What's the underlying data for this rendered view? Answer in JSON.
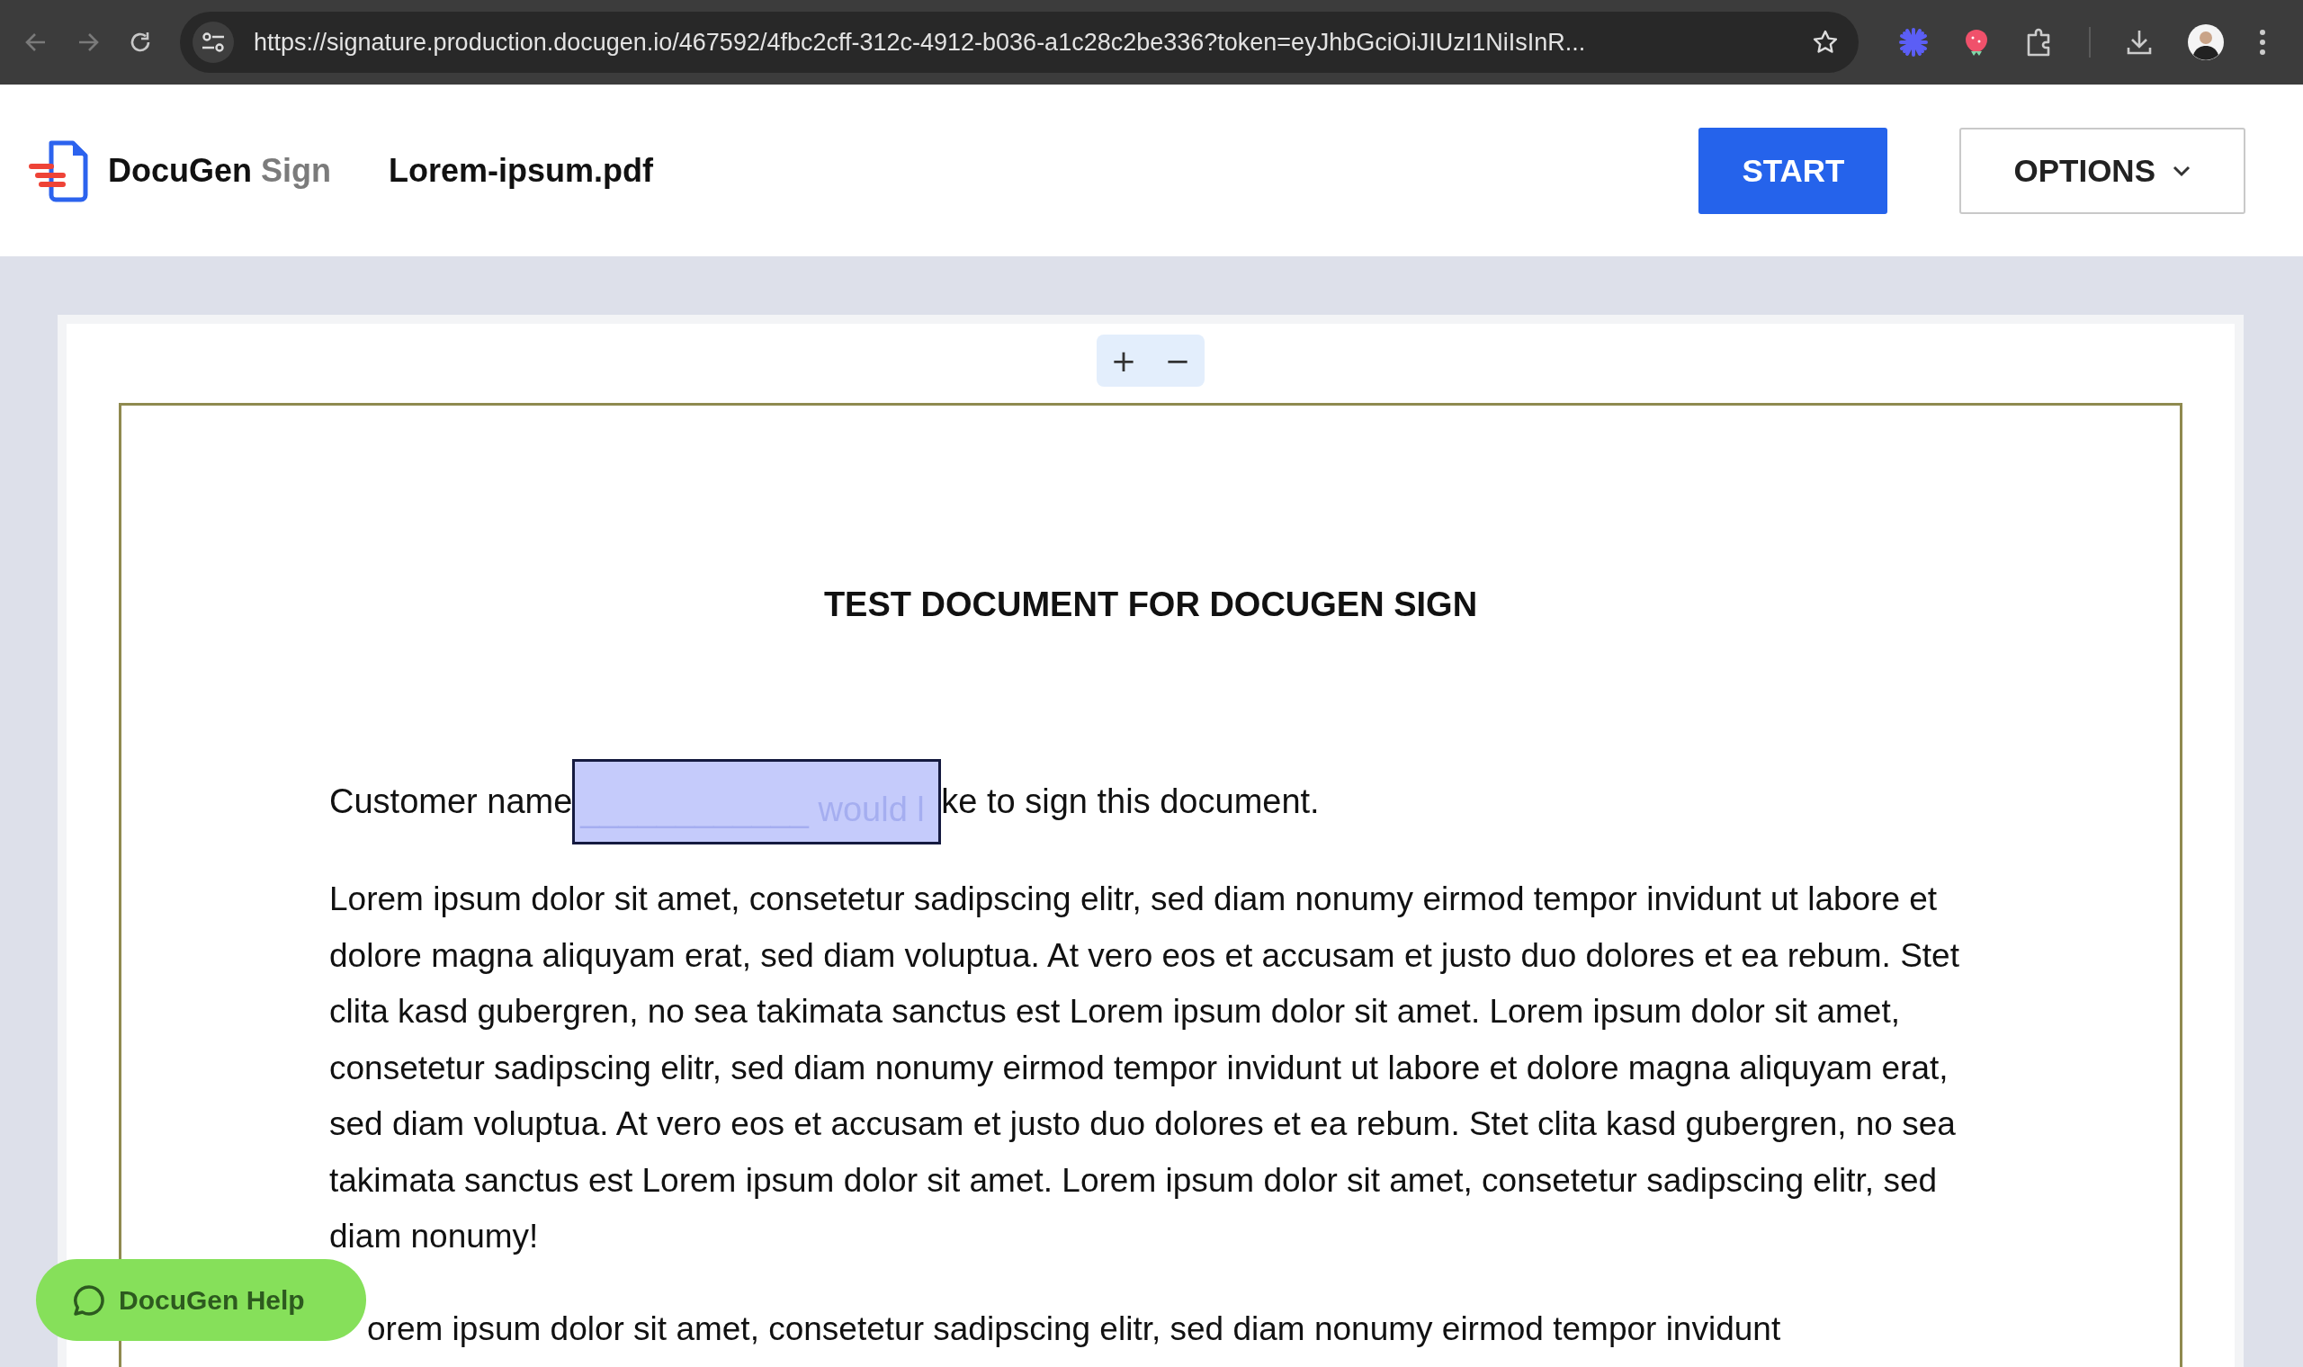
{
  "browser": {
    "url": "https://signature.production.docugen.io/467592/4fbc2cff-312c-4912-b036-a1c28c2be336?token=eyJhbGciOiJIUzI1NiIsInR..."
  },
  "header": {
    "brand": "DocuGen",
    "brand_suffix": "Sign",
    "file_name": "Lorem-ipsum.pdf",
    "buttons": [
      {
        "label": "START",
        "kind": "primary"
      },
      {
        "label": "OPTIONS",
        "kind": "dropdown"
      }
    ]
  },
  "zoom_controls": [
    "+",
    "−"
  ],
  "document": {
    "title": "TEST DOCUMENT FOR DOCUGEN SIGN",
    "intro": {
      "before": "Customer name",
      "field_covered_text": "____________ would l",
      "after": "ke to sign this document."
    },
    "paragraphs": [
      "Lorem ipsum dolor sit amet, consetetur sadipscing elitr, sed diam nonumy eirmod tempor invidunt ut labore et dolore magna aliquyam erat, sed diam voluptua. At vero eos et accusam et justo duo dolores et ea rebum. Stet clita kasd gubergren, no sea takimata sanctus est Lorem ipsum dolor sit amet. Lorem ipsum dolor sit amet, consetetur sadipscing elitr, sed diam nonumy eirmod tempor invidunt ut labore et dolore magna aliquyam erat, sed diam voluptua. At vero eos et accusam et justo duo dolores et ea rebum. Stet clita kasd gubergren, no sea takimata sanctus est Lorem ipsum dolor sit amet. Lorem ipsum dolor sit amet, consetetur sadipscing elitr, sed diam nonumy!",
      "orem ipsum dolor sit amet, consetetur sadipscing elitr, sed diam nonumy eirmod tempor invidunt"
    ]
  },
  "help_button": {
    "label": "DocuGen Help"
  }
}
